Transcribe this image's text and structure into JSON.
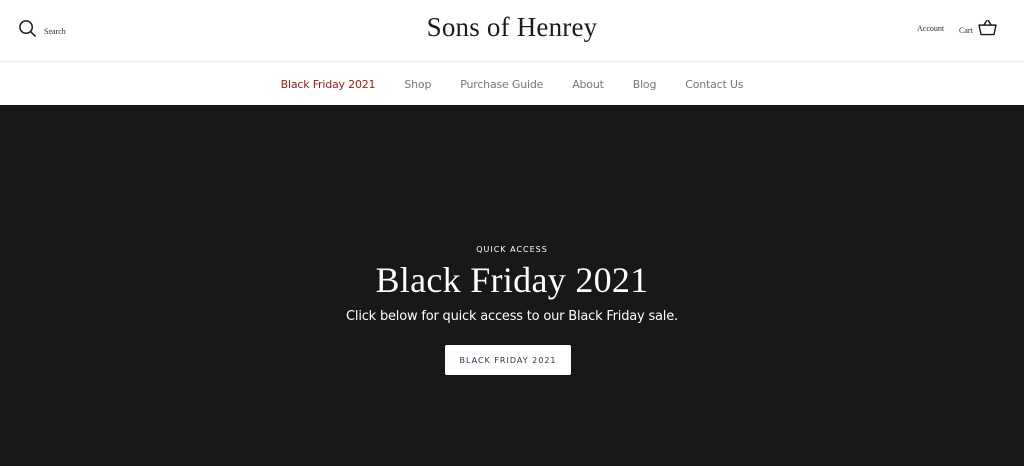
{
  "header": {
    "search_label": "Search",
    "logo": "Sons of Henrey",
    "account_label": "Account",
    "cart_label": "Cart"
  },
  "nav": {
    "items": [
      {
        "label": "Black Friday 2021",
        "active": true
      },
      {
        "label": "Shop"
      },
      {
        "label": "Purchase Guide"
      },
      {
        "label": "About"
      },
      {
        "label": "Blog"
      },
      {
        "label": "Contact Us"
      }
    ]
  },
  "hero": {
    "eyebrow": "QUICK ACCESS",
    "title": "Black Friday 2021",
    "subtitle": "Click below for quick access to our Black Friday sale.",
    "button_label": "BLACK FRIDAY 2021"
  },
  "colors": {
    "accent": "#a31d12",
    "hero_bg": "#181818",
    "nav_text": "#777777"
  },
  "icons": [
    "search-icon",
    "cart-basket-icon"
  ]
}
